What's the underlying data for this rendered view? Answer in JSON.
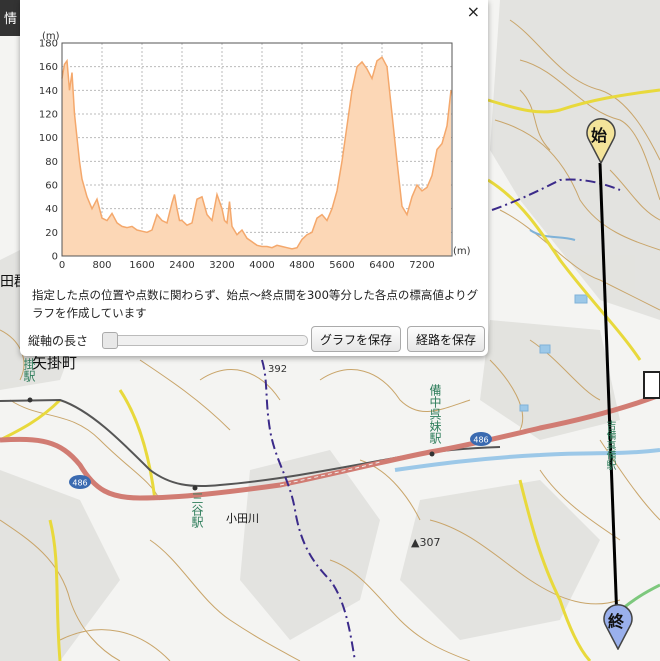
{
  "info_tab": "情",
  "panel": {
    "close_label": "×",
    "note": "指定した点の位置や点数に関わらず、始点〜終点間を300等分した各点の標高値よりグラフを作成しています",
    "scale_label": "縦軸の長さ",
    "save_graph_label": "グラフを保存",
    "save_route_label": "経路を保存"
  },
  "map": {
    "labels": {
      "district": "田郡",
      "town": "矢掛町",
      "station_yakage": "掛駅",
      "station_bichu_imo": "備中呉妹駅",
      "station_mitani": "三谷駅",
      "station_right": "吉備真備駅",
      "river": "小田川",
      "spot_height": "▲307",
      "route_392": "392",
      "route_486_a": "486",
      "route_486_b": "486"
    },
    "start_marker": "始",
    "end_marker": "終",
    "colors": {
      "road": "#d17c73",
      "national_route": "#e8d93c",
      "contour": "#c9a56a",
      "railway": "#555555",
      "boundary": "#3b2a8a",
      "water": "#9cc8e8"
    }
  },
  "chart_data": {
    "type": "area",
    "xlabel": "(m)",
    "ylabel": "(m)",
    "xlim": [
      0,
      7800
    ],
    "ylim": [
      0,
      180
    ],
    "x_ticks": [
      0,
      800,
      1600,
      2400,
      3200,
      4000,
      4800,
      5600,
      6400,
      7200
    ],
    "y_ticks": [
      0,
      20,
      40,
      60,
      80,
      100,
      120,
      140,
      160,
      180
    ],
    "grid": true,
    "color": "#f4a86c",
    "series": [
      {
        "x": [
          0,
          50,
          100,
          150,
          200,
          250,
          300,
          350,
          400,
          500,
          600,
          700,
          800,
          900,
          1000,
          1100,
          1200,
          1300,
          1400,
          1500,
          1600,
          1700,
          1800,
          1900,
          2000,
          2100,
          2200,
          2250,
          2300,
          2350,
          2400,
          2500,
          2600,
          2700,
          2800,
          2900,
          3000,
          3100,
          3200,
          3250,
          3300,
          3350,
          3400,
          3500,
          3600,
          3700,
          3800,
          3900,
          4000,
          4100,
          4200,
          4300,
          4400,
          4500,
          4600,
          4700,
          4800,
          4900,
          5000,
          5100,
          5200,
          5300,
          5400,
          5500,
          5600,
          5700,
          5800,
          5900,
          6000,
          6100,
          6200,
          6300,
          6400,
          6500,
          6600,
          6700,
          6800,
          6900,
          7000,
          7100,
          7200,
          7300,
          7400,
          7500,
          7600,
          7700,
          7780
        ],
        "values": [
          150,
          162,
          165,
          140,
          155,
          120,
          100,
          80,
          65,
          50,
          40,
          48,
          32,
          30,
          36,
          28,
          25,
          24,
          25,
          22,
          21,
          20,
          22,
          35,
          30,
          28,
          45,
          52,
          40,
          30,
          30,
          26,
          28,
          48,
          50,
          35,
          30,
          52,
          40,
          30,
          28,
          46,
          25,
          18,
          22,
          15,
          12,
          9,
          8,
          8,
          7,
          9,
          8,
          7,
          6,
          7,
          14,
          18,
          20,
          32,
          35,
          30,
          40,
          55,
          80,
          110,
          140,
          160,
          164,
          158,
          150,
          165,
          168,
          160,
          120,
          80,
          42,
          35,
          50,
          60,
          55,
          58,
          68,
          90,
          95,
          110,
          140
        ]
      }
    ]
  }
}
